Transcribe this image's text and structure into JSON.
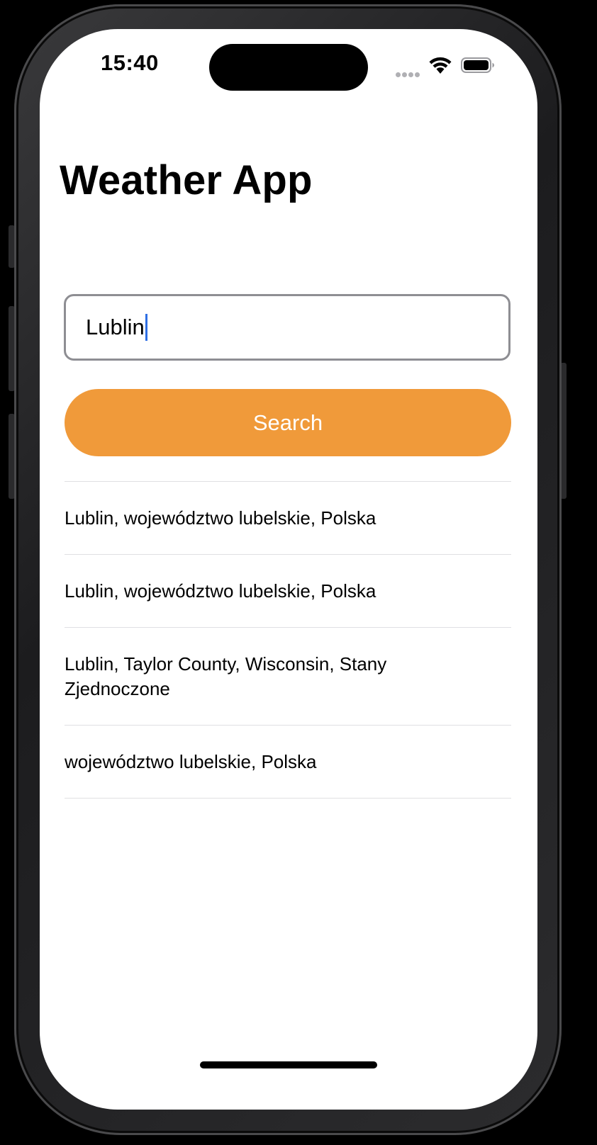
{
  "status_bar": {
    "time": "15:40",
    "icons": [
      "cellular-icon",
      "wifi-icon",
      "battery-icon"
    ]
  },
  "app": {
    "title": "Weather App"
  },
  "search": {
    "value": "Lublin",
    "button_label": "Search"
  },
  "results": [
    "Lublin, województwo lubelskie, Polska",
    "Lublin, województwo lubelskie, Polska",
    "Lublin, Taylor County, Wisconsin, Stany Zjednoczone",
    "województwo lubelskie, Polska"
  ],
  "colors": {
    "accent": "#f09a3a",
    "caret": "#2f6fe4",
    "field_border": "#8e8e93",
    "divider": "#e0e0e3"
  }
}
